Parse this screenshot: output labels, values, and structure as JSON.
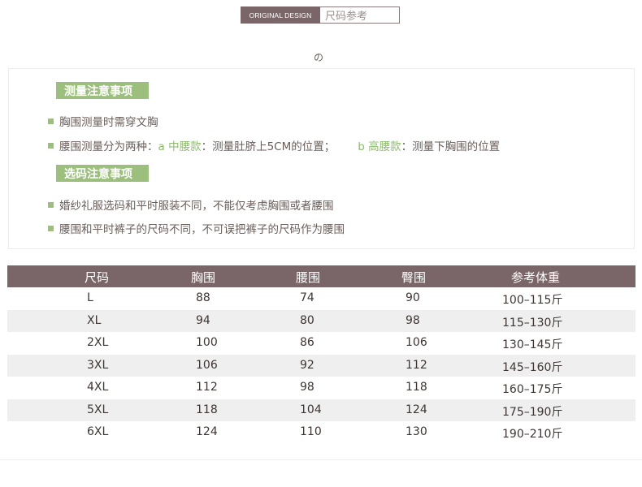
{
  "header": {
    "badge": "ORIGINAL DESIGN",
    "title": "尺码参考",
    "mark": "の"
  },
  "measure": {
    "title": "测量注意事项",
    "line1": "胸围测量时需穿文胸",
    "line2_prefix": "腰围测量分为两种：",
    "line2_a_label": "a 中腰款",
    "line2_a_text": "：测量肚脐上5CM的位置；",
    "line2_b_label": "b 高腰款",
    "line2_b_text": "：测量下胸围的位置"
  },
  "select": {
    "title": "选码注意事项",
    "line1": "婚纱礼服选码和平时服装不同，不能仅考虑胸围或者腰围",
    "line2": "腰围和平时裤子的尺码不同，不可误把裤子的尺码作为腰围"
  },
  "table": {
    "headers": [
      "尺码",
      "胸围",
      "腰围",
      "臀围",
      "参考体重"
    ],
    "rows": [
      [
        "L",
        "88",
        "74",
        "90",
        "100–115斤"
      ],
      [
        "XL",
        "94",
        "80",
        "98",
        "115–130斤"
      ],
      [
        "2XL",
        "100",
        "86",
        "106",
        "130–145斤"
      ],
      [
        "3XL",
        "106",
        "92",
        "112",
        "145–160斤"
      ],
      [
        "4XL",
        "112",
        "98",
        "118",
        "160–175斤"
      ],
      [
        "5XL",
        "118",
        "104",
        "124",
        "175–190斤"
      ],
      [
        "6XL",
        "124",
        "110",
        "130",
        "190–210斤"
      ]
    ]
  },
  "colors": {
    "header_bg": "#7a6669",
    "accent_green": "#9cbf7e",
    "row_alt": "#efefef"
  }
}
